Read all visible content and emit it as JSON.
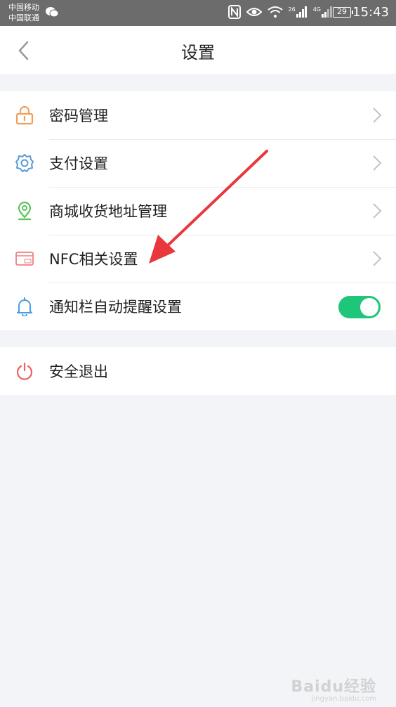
{
  "status_bar": {
    "carrier_1": "中国移动",
    "carrier_2": "中国联通",
    "signal_1": "26",
    "signal_2": "4G",
    "battery": "29",
    "time": "15:43"
  },
  "header": {
    "title": "设置"
  },
  "settings_group": {
    "items": [
      {
        "label": "密码管理",
        "icon": "lock-icon"
      },
      {
        "label": "支付设置",
        "icon": "gear-icon"
      },
      {
        "label": "商城收货地址管理",
        "icon": "location-pin-icon"
      },
      {
        "label": "NFC相关设置",
        "icon": "nfc-card-icon"
      },
      {
        "label": "通知栏自动提醒设置",
        "icon": "bell-icon",
        "toggle_on": true
      }
    ]
  },
  "logout": {
    "label": "安全退出",
    "icon": "power-icon"
  },
  "colors": {
    "toggle_on": "#1fc679",
    "annotation_arrow": "#e8383d",
    "lock_icon": "#f0a05a",
    "gear_icon": "#5b9bd5",
    "pin_icon": "#5cc35c",
    "nfc_icon": "#f08080",
    "bell_icon": "#4b9be3",
    "power_icon": "#ee5f5f"
  },
  "watermark": {
    "brand": "Baidu经验",
    "sub": "jingyan.baidu.com"
  }
}
